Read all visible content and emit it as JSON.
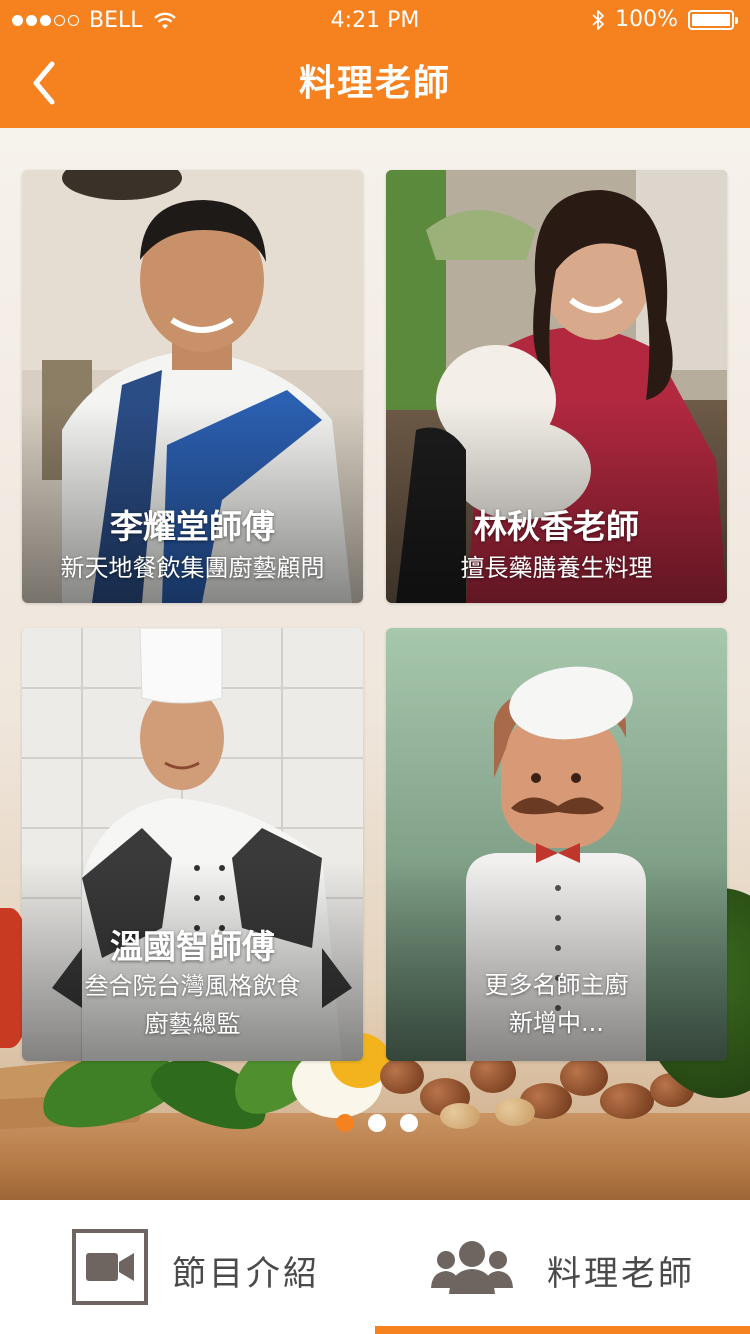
{
  "status_bar": {
    "carrier": "BELL",
    "time": "4:21 PM",
    "battery": "100%",
    "signal_bars_filled": 3,
    "signal_bars_total": 5
  },
  "header": {
    "title": "料理老師",
    "back_icon": "chevron-left-icon"
  },
  "colors": {
    "accent": "#f6811f",
    "tab_text": "#4a4a4a",
    "white": "#ffffff"
  },
  "teachers": [
    {
      "name": "李耀堂師傅",
      "description": "新天地餐飲集團廚藝顧問"
    },
    {
      "name": "林秋香老師",
      "description": "擅長藥膳養生料理"
    },
    {
      "name": "溫國智師傅",
      "description": "叁合院台灣風格飲食\n廚藝總監"
    },
    {
      "name": "",
      "description": "更多名師主廚\n新增中..."
    }
  ],
  "pager": {
    "pages": 3,
    "current": 1
  },
  "tabs": [
    {
      "label": "節目介紹",
      "icon": "video-camera-icon",
      "active": false
    },
    {
      "label": "料理老師",
      "icon": "group-people-icon",
      "active": true
    }
  ]
}
